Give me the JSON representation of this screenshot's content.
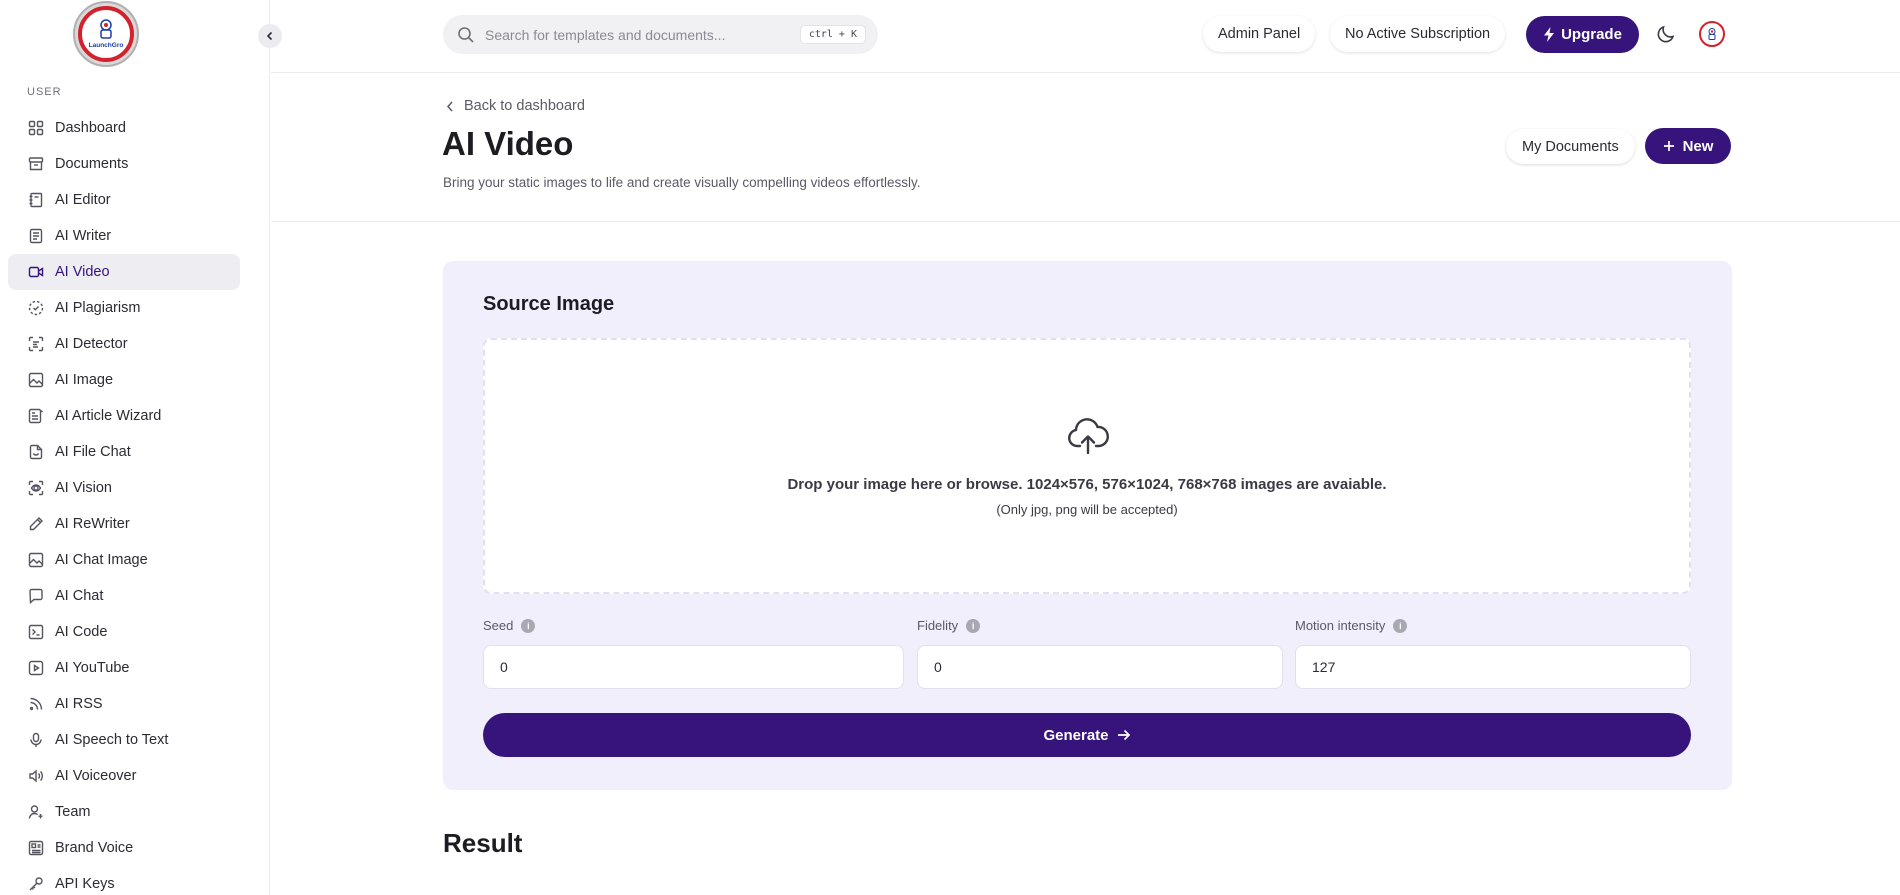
{
  "brand": {
    "logo_text": "LaunchGro"
  },
  "sidebar": {
    "section_label": "USER",
    "items": [
      {
        "label": "Dashboard",
        "icon": "grid-icon"
      },
      {
        "label": "Documents",
        "icon": "archive-icon"
      },
      {
        "label": "AI Editor",
        "icon": "notebook-icon"
      },
      {
        "label": "AI Writer",
        "icon": "document-icon"
      },
      {
        "label": "AI Video",
        "icon": "video-icon",
        "active": true
      },
      {
        "label": "AI Plagiarism",
        "icon": "dashed-check-circle-icon"
      },
      {
        "label": "AI Detector",
        "icon": "scan-text-icon"
      },
      {
        "label": "AI Image",
        "icon": "image-icon"
      },
      {
        "label": "AI Article Wizard",
        "icon": "article-wizard-icon"
      },
      {
        "label": "AI File Chat",
        "icon": "file-chat-icon"
      },
      {
        "label": "AI Vision",
        "icon": "scan-eye-icon"
      },
      {
        "label": "AI ReWriter",
        "icon": "pencil-icon"
      },
      {
        "label": "AI Chat Image",
        "icon": "image-icon"
      },
      {
        "label": "AI Chat",
        "icon": "chat-bubble-icon"
      },
      {
        "label": "AI Code",
        "icon": "terminal-icon"
      },
      {
        "label": "AI YouTube",
        "icon": "youtube-icon"
      },
      {
        "label": "AI RSS",
        "icon": "rss-icon"
      },
      {
        "label": "AI Speech to Text",
        "icon": "microphone-icon"
      },
      {
        "label": "AI Voiceover",
        "icon": "speaker-icon"
      },
      {
        "label": "Team",
        "icon": "user-plus-icon"
      },
      {
        "label": "Brand Voice",
        "icon": "brand-voice-icon"
      },
      {
        "label": "API Keys",
        "icon": "key-icon"
      }
    ]
  },
  "topbar": {
    "search_placeholder": "Search for templates and documents...",
    "search_shortcut": "ctrl + K",
    "admin_panel": "Admin Panel",
    "subscription": "No Active Subscription",
    "upgrade": "Upgrade"
  },
  "header": {
    "back_label": "Back to dashboard",
    "title": "AI Video",
    "subtitle": "Bring your static images to life and create visually compelling videos effortlessly.",
    "my_documents": "My Documents",
    "new_label": "New"
  },
  "source": {
    "title": "Source Image",
    "drop_main": "Drop your image here or browse. 1024×576, 576×1024, 768×768 images are avaiable.",
    "drop_sub": "(Only jpg, png will be accepted)",
    "fields": {
      "seed": {
        "label": "Seed",
        "value": "0"
      },
      "fidelity": {
        "label": "Fidelity",
        "value": "0"
      },
      "motion": {
        "label": "Motion intensity",
        "value": "127"
      }
    },
    "generate_label": "Generate"
  },
  "result": {
    "title": "Result"
  },
  "colors": {
    "accent": "#36147c",
    "card_bg": "#f1effb",
    "active_bg": "#ededf2"
  }
}
